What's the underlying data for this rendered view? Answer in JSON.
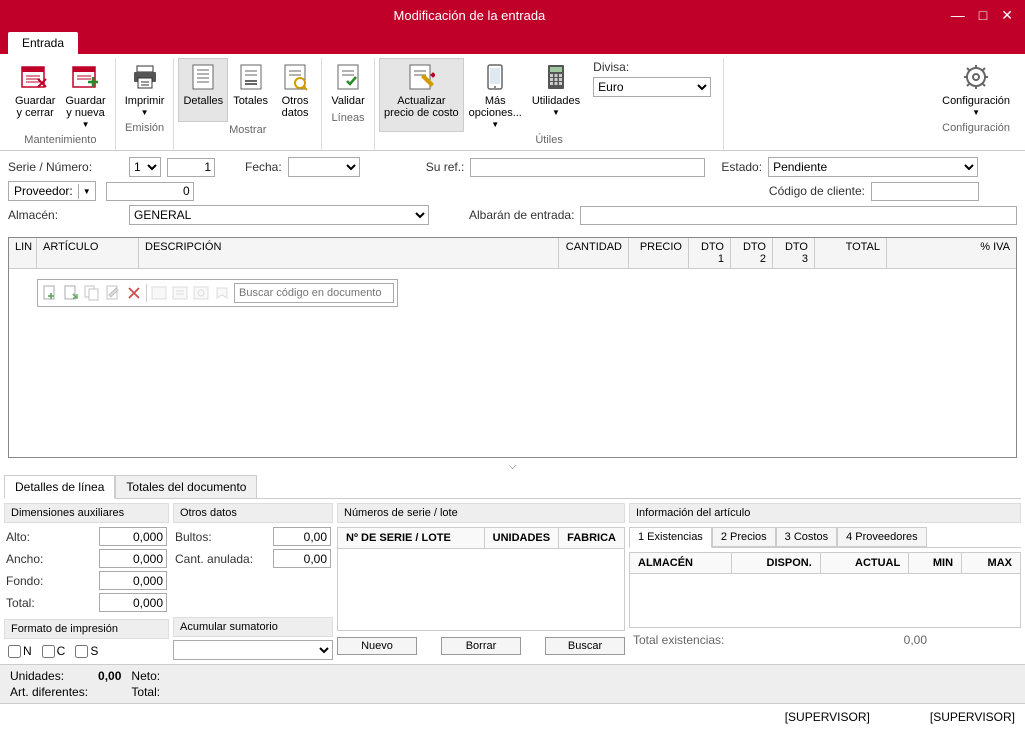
{
  "title": "Modificación de la entrada",
  "main_tab": "Entrada",
  "ribbon": {
    "guardar_cerrar": "Guardar\ny cerrar",
    "guardar_nueva": "Guardar\ny nueva",
    "mantenimiento": "Mantenimiento",
    "imprimir": "Imprimir",
    "emision": "Emisión",
    "detalles": "Detalles",
    "totales": "Totales",
    "otros_datos": "Otros\ndatos",
    "mostrar": "Mostrar",
    "validar": "Validar",
    "lineas": "Líneas",
    "actualizar": "Actualizar\nprecio de costo",
    "mas_opciones": "Más\nopciones...",
    "utilidades": "Utilidades",
    "utiles": "Útiles",
    "divisa_label": "Divisa:",
    "divisa_value": "Euro",
    "configuracion": "Configuración"
  },
  "form": {
    "serie_numero_label": "Serie / Número:",
    "serie_value": "1",
    "numero_value": "1",
    "fecha_label": "Fecha:",
    "fecha_value": "",
    "su_ref_label": "Su ref.:",
    "estado_label": "Estado:",
    "estado_value": "Pendiente",
    "proveedor_label": "Proveedor:",
    "proveedor_value": "0",
    "codigo_cliente_label": "Código de cliente:",
    "almacen_label": "Almacén:",
    "almacen_value": "GENERAL",
    "albaran_label": "Albarán de entrada:"
  },
  "grid_headers": {
    "lin": "LIN",
    "articulo": "ARTÍCULO",
    "descripcion": "DESCRIPCIÓN",
    "cantidad": "CANTIDAD",
    "precio": "PRECIO",
    "dto1": "DTO 1",
    "dto2": "DTO 2",
    "dto3": "DTO 3",
    "total": "TOTAL",
    "iva": "% IVA"
  },
  "grid_search_placeholder": "Buscar código en documento",
  "bottom_tabs": {
    "detalles": "Detalles de línea",
    "totales": "Totales del documento"
  },
  "dims": {
    "header": "Dimensiones auxiliares",
    "alto": "Alto:",
    "alto_v": "0,000",
    "ancho": "Ancho:",
    "ancho_v": "0,000",
    "fondo": "Fondo:",
    "fondo_v": "0,000",
    "total": "Total:",
    "total_v": "0,000",
    "formato": "Formato de impresión",
    "n": "N",
    "c": "C",
    "s": "S"
  },
  "otros": {
    "header": "Otros datos",
    "bultos": "Bultos:",
    "bultos_v": "0,00",
    "cant_anulada": "Cant. anulada:",
    "cant_anulada_v": "0,00",
    "acumular": "Acumular sumatorio"
  },
  "serie_lote": {
    "header": "Números de serie / lote",
    "col1": "Nº DE SERIE / LOTE",
    "col2": "UNIDADES",
    "col3": "FABRICA",
    "nuevo": "Nuevo",
    "borrar": "Borrar",
    "buscar": "Buscar"
  },
  "info": {
    "header": "Información del artículo",
    "tab1": "1 Existencias",
    "tab2": "2 Precios",
    "tab3": "3 Costos",
    "tab4": "4 Proveedores",
    "col1": "ALMACÉN",
    "col2": "DISPON.",
    "col3": "ACTUAL",
    "col4": "MIN",
    "col5": "MAX",
    "total_exist": "Total existencias:",
    "total_exist_v": "0,00"
  },
  "status": {
    "unidades": "Unidades:",
    "unidades_v": "0,00",
    "neto": "Neto:",
    "art_dif": "Art. diferentes:",
    "total": "Total:"
  },
  "footer": {
    "supervisor": "[SUPERVISOR]"
  }
}
